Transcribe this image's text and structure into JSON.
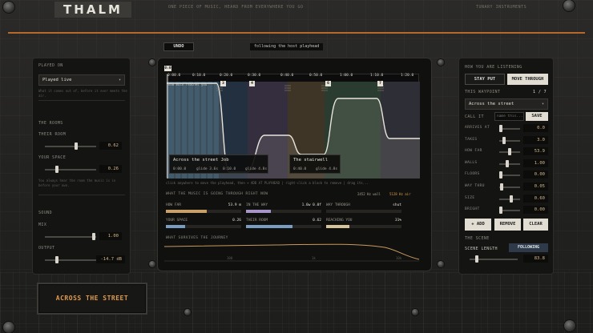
{
  "header": {
    "logo": "THALM",
    "tagline": "ONE PIECE OF MUSIC, HEARD FROM EVERYWHERE YOU GO",
    "maker": "TUNARY INSTRUMENTS"
  },
  "toolbar": {
    "undo_label": "UNDO",
    "status": "following the host playhead"
  },
  "left": {
    "played_on_label": "PLAYED ON",
    "played_on_value": "Played live",
    "played_on_hint": "What it comes out of, before it ever meets the air.",
    "rooms_label": "THE ROOMS",
    "their_room_label": "THEIR ROOM",
    "their_room_value": "0.62",
    "your_space_label": "YOUR SPACE",
    "your_space_value": "0.26",
    "rooms_hint": "You always hear the room the music is in before your own.",
    "sound_label": "SOUND",
    "mix_label": "MIX",
    "mix_value": "1.00",
    "output_label": "OUTPUT",
    "output_value": "-14.7 dB"
  },
  "plate_label": "ACROSS THE STREET",
  "timeline": {
    "ticks": [
      "0:00.0",
      "0:10.0",
      "0:20.0",
      "0:30.0",
      "0:40.0",
      "0:50.0",
      "1:00.0",
      "1:10.0",
      "1:20.0"
    ],
    "playhead_label": "0:0",
    "playhead_note": "how much reaches you",
    "markers": [
      "3",
      "4",
      "6",
      "7"
    ],
    "card1": {
      "title": "Across the street Job",
      "time": "0:00.0",
      "glide1": "glide 3.6s",
      "time2": "0:10.0",
      "glide2": "glide 4.8s"
    },
    "card2": {
      "title": "The stairwell",
      "time": "0:40.0",
      "glide": "glide 4.8s"
    },
    "hint": "click anywhere to move the playhead, then + ADD AT PLAYHEAD  |  right-click a block to remove  |  drag its..."
  },
  "meters": {
    "title": "WHAT THE MUSIC IS GOING THROUGH RIGHT NOW",
    "wall_freq": "2452 Hz wall",
    "air_freq": "5128 Hz air",
    "rows": [
      {
        "label": "HOW FAR",
        "value": "53.9 m",
        "fill": 0.54,
        "color": "#c9a06a"
      },
      {
        "label": "IN THE WAY",
        "value": "1.0w 0.0f",
        "fill": 0.33,
        "color": "#a795c8"
      },
      {
        "label": "WAY THROUGH",
        "value": "shut",
        "fill": 0.0,
        "color": "#7ab08a"
      },
      {
        "label": "YOUR SPACE",
        "value": "0.26",
        "fill": 0.26,
        "color": "#7a9cc0"
      },
      {
        "label": "THEIR ROOM",
        "value": "0.62",
        "fill": 0.62,
        "color": "#7a9cc0"
      },
      {
        "label": "REACHING YOU",
        "value": "31%",
        "fill": 0.31,
        "color": "#d8c49a"
      }
    ],
    "curve_label": "WHAT SURVIVES THE JOURNEY",
    "freq_ticks": [
      "100",
      "1k",
      "10k"
    ]
  },
  "right": {
    "listening_label": "HOW YOU ARE LISTENING",
    "stay_put_label": "STAY PUT",
    "move_through_label": "MOVE THROUGH",
    "waypoint_label": "THIS WAYPOINT",
    "waypoint_count": "1 / 7",
    "waypoint_value": "Across the street",
    "call_it_label": "CALL IT",
    "name_placeholder": "name this...",
    "save_label": "SAVE",
    "params": [
      {
        "label": "ARRIVES AT",
        "value": "0.0",
        "pos": 0.0
      },
      {
        "label": "TAKES",
        "value": "3.0",
        "pos": 0.2
      },
      {
        "label": "HOW FAR",
        "value": "53.9",
        "pos": 0.5
      },
      {
        "label": "WALLS",
        "value": "1.00",
        "pos": 0.35
      },
      {
        "label": "FLOORS",
        "value": "0.00",
        "pos": 0.0
      },
      {
        "label": "WAY THRU",
        "value": "0.05",
        "pos": 0.05
      },
      {
        "label": "SIZE",
        "value": "0.60",
        "pos": 0.6
      },
      {
        "label": "BRIGHT",
        "value": "0.00",
        "pos": 0.0
      }
    ],
    "add_label": "+ ADD",
    "remove_label": "REMOVE",
    "clear_label": "CLEAR",
    "scene_label": "THE SCENE",
    "scene_length_label": "SCENE LENGTH",
    "following_label": "FOLLOWING",
    "scene_length_value": "83.8"
  }
}
